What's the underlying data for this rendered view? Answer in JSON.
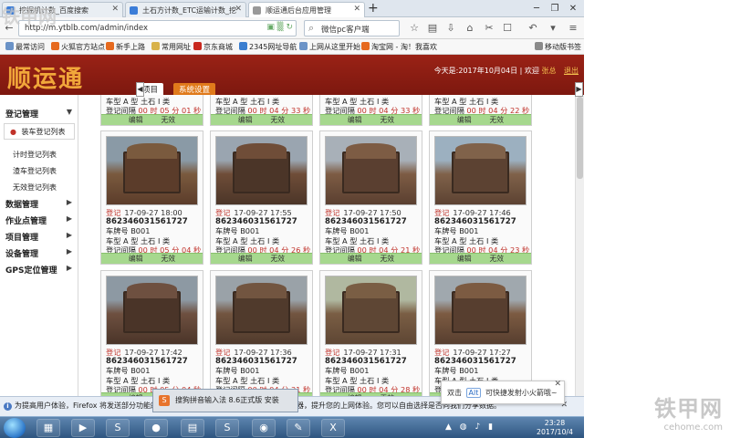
{
  "browser": {
    "tabs": [
      {
        "label": "挖掘机计数_百度搜索"
      },
      {
        "label": "土石方计数_ETC运输计数_挖"
      },
      {
        "label": "顺运通后台应用管理"
      }
    ],
    "url": "http://m.ytblb.com/admin/index",
    "search_text": "微信pc客户端",
    "bookmarks": [
      "最常访问",
      "火狐官方站点",
      "新手上路",
      "常用网址",
      "京东商城",
      "2345网址导航",
      "上网从这里开始",
      "淘宝网 - 淘！我喜欢",
      "移动版书签"
    ]
  },
  "app": {
    "logo": "顺运通",
    "date_text": "今天是:2017年10月04日",
    "welcome_text": "欢迎",
    "user": "张总",
    "logout": "退出",
    "menu_tabs": [
      "项目",
      "系统设置"
    ]
  },
  "sidebar": {
    "sections": [
      {
        "label": "登记管理"
      },
      {
        "label": "数据管理"
      },
      {
        "label": "作业点管理"
      },
      {
        "label": "项目管理"
      },
      {
        "label": "设备管理"
      },
      {
        "label": "GPS定位管理"
      }
    ],
    "active_item": "装车登记列表",
    "sub_items": [
      "计时登记列表",
      "渣车登记列表",
      "无效登记列表"
    ]
  },
  "labels": {
    "plate_prefix": "车牌号",
    "type_prefix": "车型",
    "interval_prefix": "登记间隔",
    "edit": "编辑",
    "invalid": "无效"
  },
  "top_partial": [
    {
      "line": "车型 A 型 土石 I 类",
      "interval": "00 时 05 分 01 秒"
    },
    {
      "line": "车型 A 型 土石 I 类",
      "interval": "00 时 04 分 33 秒"
    },
    {
      "line": "车型 A 型 土石 I 类",
      "interval": "00 时 04 分 33 秒"
    },
    {
      "line": "车型 A 型 土石 I 类",
      "interval": "00 时 04 分 22 秒"
    }
  ],
  "cards": [
    {
      "status": "登记",
      "time": "17-09-27 18:00",
      "code": "862346031561727",
      "plate": "B001",
      "type": "A 型 土石 I 类",
      "interval": "00 时 05 分 04 秒"
    },
    {
      "status": "登记",
      "time": "17-09-27 17:55",
      "code": "862346031561727",
      "plate": "B001",
      "type": "A 型 土石 I 类",
      "interval": "00 时 04 分 26 秒"
    },
    {
      "status": "登记",
      "time": "17-09-27 17:50",
      "code": "862346031561727",
      "plate": "B001",
      "type": "A 型 土石 I 类",
      "interval": "00 时 04 分 21 秒"
    },
    {
      "status": "登记",
      "time": "17-09-27 17:46",
      "code": "862346031561727",
      "plate": "B001",
      "type": "A 型 土石 I 类",
      "interval": "00 时 04 分 23 秒"
    },
    {
      "status": "登记",
      "time": "17-09-27 17:42",
      "code": "862346031561727",
      "plate": "B001",
      "type": "A 型 土石 I 类",
      "interval": "00 时 05 分 04 秒"
    },
    {
      "status": "登记",
      "time": "17-09-27 17:36",
      "code": "862346031561727",
      "plate": "B001",
      "type": "A 型 土石 I 类",
      "interval": "00 时 04 分 31 秒"
    },
    {
      "status": "登记",
      "time": "17-09-27 17:31",
      "code": "862346031561727",
      "plate": "B001",
      "type": "A 型 土石 I 类",
      "interval": "00 时 04 分 28 秒"
    },
    {
      "status": "登记",
      "time": "17-09-27 17:27",
      "code": "862346031561727",
      "plate": "B001",
      "type": "A 型 土石 I 类",
      "interval": "00 时 04 分 39 秒"
    }
  ],
  "notices": {
    "firefox": "为提高用户体验，Firefox 将发送部分功能的使用情况给我们，用于进一步优化火狐浏览器，提升您的上网体验。您可以自由选择是否向我们分享数据。",
    "sogou": "搜狗拼音输入法 8.6正式版 安装",
    "popup_prefix": "双击",
    "popup_key": "Alt",
    "popup_suffix": "可快捷发射小火箭哦~"
  },
  "taskbar": {
    "time": "23:28",
    "date": "2017/10/4"
  },
  "watermark": {
    "brand": "铁甲网",
    "site": "cehome.com"
  },
  "colors": {
    "header_red": "#8c1c12",
    "logo_orange": "#f1a73a",
    "status_red": "#c0322a",
    "action_green": "#a6d88e"
  }
}
